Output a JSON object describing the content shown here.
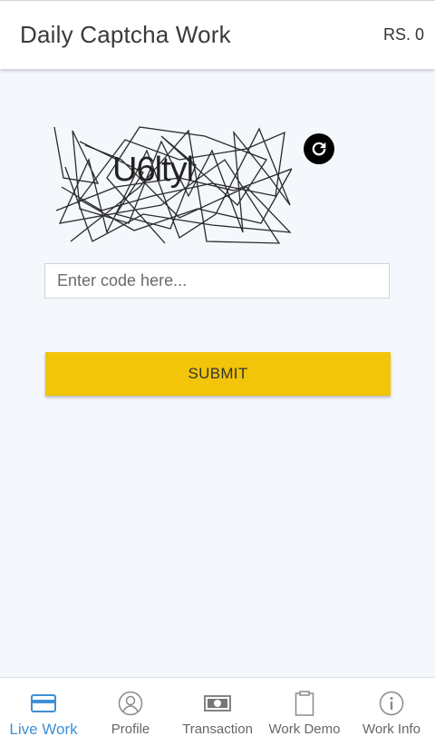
{
  "header": {
    "title": "Daily Captcha Work",
    "balance": "RS. 0"
  },
  "captcha": {
    "text": "U6ltyl",
    "refresh_icon": "refresh-icon"
  },
  "form": {
    "code_placeholder": "Enter code here...",
    "code_value": "",
    "submit_label": "SUBMIT"
  },
  "bottom_nav": {
    "items": [
      {
        "label": "Live Work",
        "icon": "card-icon",
        "active": true
      },
      {
        "label": "Profile",
        "icon": "user-icon",
        "active": false
      },
      {
        "label": "Transaction",
        "icon": "money-icon",
        "active": false
      },
      {
        "label": "Work Demo",
        "icon": "clipboard-icon",
        "active": false
      },
      {
        "label": "Work Info",
        "icon": "info-icon",
        "active": false
      }
    ]
  },
  "colors": {
    "accent": "#3f8fd6",
    "submit": "#f2c40a",
    "background": "#f4f7fc"
  }
}
